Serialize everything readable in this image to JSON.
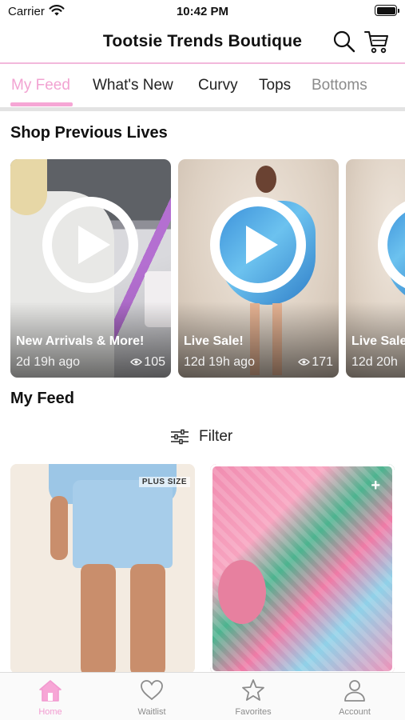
{
  "status_bar": {
    "carrier": "Carrier",
    "time": "10:42 PM"
  },
  "header": {
    "title": "Tootsie Trends Boutique",
    "search_icon": "search-icon",
    "cart_icon": "cart-icon"
  },
  "tabs": [
    {
      "label": "My Feed",
      "active": true
    },
    {
      "label": "What's New",
      "active": false
    },
    {
      "label": "Curvy",
      "active": false
    },
    {
      "label": "Tops",
      "active": false
    },
    {
      "label": "Bottoms",
      "active": false
    }
  ],
  "previous_lives": {
    "title": "Shop Previous Lives",
    "cards": [
      {
        "title": "New Arrivals & More!",
        "age": "2d 19h ago",
        "views": "105"
      },
      {
        "title": "Live Sale!",
        "age": "12d 19h ago",
        "views": "171"
      },
      {
        "title": "Live Sale",
        "age": "12d 20h",
        "views": ""
      }
    ]
  },
  "feed": {
    "title": "My Feed",
    "filter_label": "Filter",
    "products": [
      {
        "badge": "PLUS SIZE"
      },
      {
        "badge": ""
      }
    ]
  },
  "bottom_nav": [
    {
      "label": "Home",
      "icon": "home-icon",
      "active": true
    },
    {
      "label": "Waitlist",
      "icon": "heart-icon",
      "active": false
    },
    {
      "label": "Favorites",
      "icon": "star-icon",
      "active": false
    },
    {
      "label": "Account",
      "icon": "person-icon",
      "active": false
    }
  ],
  "colors": {
    "accent_pink": "#f29ad0",
    "header_rule": "#f2b8dc"
  }
}
